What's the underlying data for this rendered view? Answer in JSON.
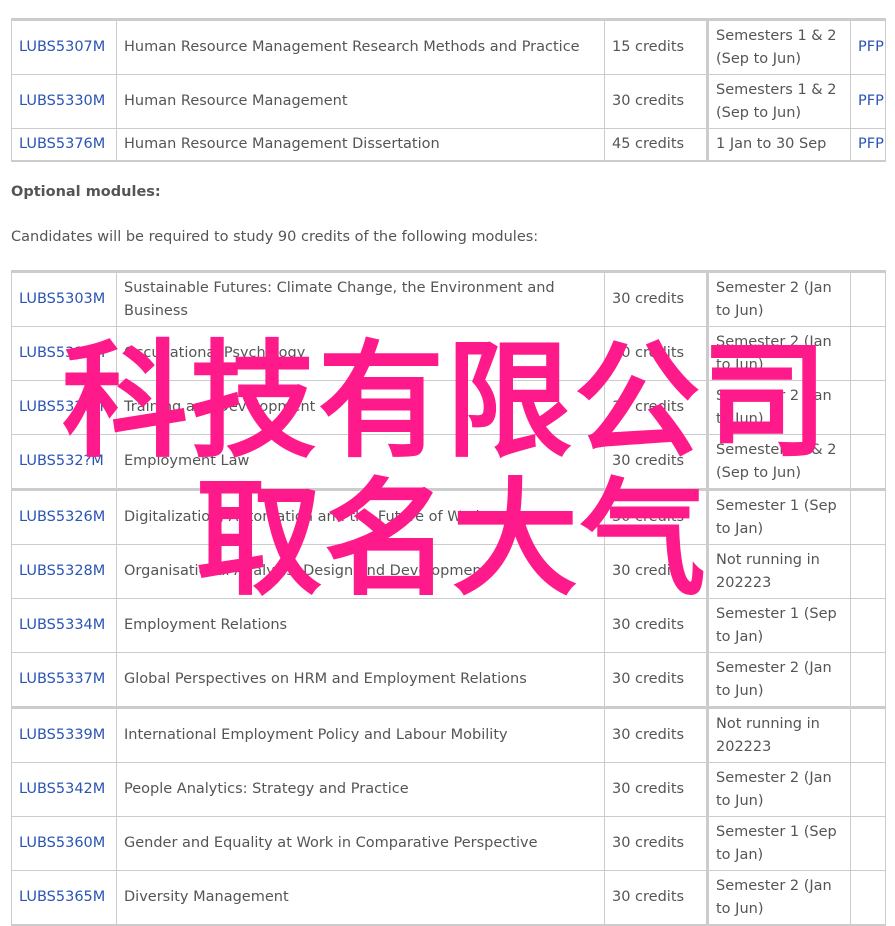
{
  "compulsory_modules": [
    {
      "code": "LUBS5307M",
      "title": "Human Resource Management Research Methods and Practice",
      "credits": "15 credits",
      "semester": "Semesters 1 & 2 (Sep to Jun)",
      "pfp": "PFP"
    },
    {
      "code": "LUBS5330M",
      "title": "Human Resource Management",
      "credits": "30 credits",
      "semester": "Semesters 1 & 2 (Sep to Jun)",
      "pfp": "PFP"
    },
    {
      "code": "LUBS5376M",
      "title": "Human Resource Management Dissertation",
      "credits": "45 credits",
      "semester": "1 Jan to 30 Sep",
      "pfp": "PFP"
    }
  ],
  "optional_heading": "Optional modules:",
  "optional_intro": "Candidates will be required to study 90 credits of the following modules:",
  "optional_modules": [
    {
      "code": "LUBS5303M",
      "title": "Sustainable Futures: Climate Change, the Environment and Business",
      "credits": "30 credits",
      "semester": "Semester 2 (Jan to Jun)"
    },
    {
      "code": "LUBS5315M",
      "title": "Occupational Psychology",
      "credits": "30 credits",
      "semester": "Semester 2 (Jan to Jun)"
    },
    {
      "code": "LUBS532?M",
      "title": "Training and Development",
      "credits": "30 credits",
      "semester": "Semester 2 (Jan to Jun)"
    },
    {
      "code": "LUBS532?M",
      "title": "Employment Law",
      "credits": "30 credits",
      "semester": "Semesters 1 & 2 (Sep to Jun)"
    },
    {
      "code": "LUBS5326M",
      "title": "Digitalization, Automation and the Future of Work",
      "credits": "30 credits",
      "semester": "Semester 1 (Sep to Jan)"
    },
    {
      "code": "LUBS5328M",
      "title": "Organisational Analysis, Design and Development",
      "credits": "30 credits",
      "semester": "Not running in 202223"
    },
    {
      "code": "LUBS5334M",
      "title": "Employment Relations",
      "credits": "30 credits",
      "semester": "Semester 1 (Sep to Jan)"
    },
    {
      "code": "LUBS5337M",
      "title": "Global Perspectives on HRM and Employment Relations",
      "credits": "30 credits",
      "semester": "Semester 2 (Jan to Jun)"
    },
    {
      "code": "LUBS5339M",
      "title": "International Employment Policy and Labour Mobility",
      "credits": "30 credits",
      "semester": "Not running in 202223"
    },
    {
      "code": "LUBS5342M",
      "title": "People Analytics: Strategy and Practice",
      "credits": "30 credits",
      "semester": "Semester 2 (Jan to Jun)"
    },
    {
      "code": "LUBS5360M",
      "title": "Gender and Equality at Work in Comparative Perspective",
      "credits": "30 credits",
      "semester": "Semester 1 (Sep to Jan)"
    },
    {
      "code": "LUBS5365M",
      "title": "Diversity Management",
      "credits": "30 credits",
      "semester": "Semester 2 (Jan to Jun)"
    }
  ],
  "overlay": {
    "line1": "科技有限公司",
    "line2": "取名大气",
    "color": "#ff1a8c"
  },
  "colors": {
    "link": "#2b55b3",
    "text": "#555555",
    "border": "#cccccc"
  }
}
